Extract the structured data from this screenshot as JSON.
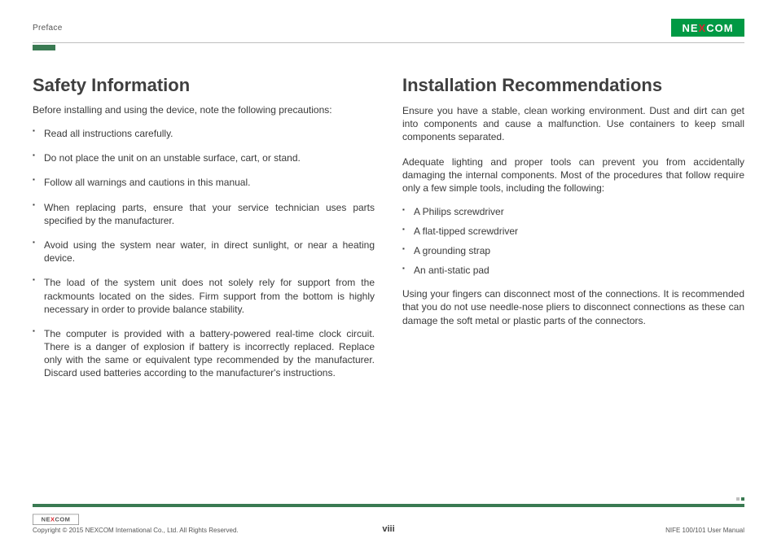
{
  "header": {
    "section_label": "Preface",
    "logo_text": "NEXCOM"
  },
  "left_column": {
    "heading": "Safety Information",
    "intro": "Before installing and using the device, note the following precautions:",
    "bullets": [
      "Read all instructions carefully.",
      "Do not place the unit on an unstable surface, cart, or stand.",
      "Follow all warnings and cautions in this manual.",
      "When replacing parts, ensure that your service technician uses parts specified by the manufacturer.",
      "Avoid using the system near water, in direct sunlight, or near a heating device.",
      "The load of the system unit does not solely rely for support from the rackmounts located on the sides. Firm support from the bottom is highly necessary in order to provide balance stability.",
      "The computer is provided with a battery-powered real-time clock circuit. There is a danger of explosion if battery is incorrectly replaced. Replace only with the same or equivalent type recommended by the manufacturer. Discard used batteries according to the manufacturer's instructions."
    ]
  },
  "right_column": {
    "heading": "Installation Recommendations",
    "para1": "Ensure you have a stable, clean working environment. Dust and dirt can get into components and cause a malfunction. Use containers to keep small components separated.",
    "para2": "Adequate lighting and proper tools can prevent you from accidentally damaging the internal components. Most of the procedures that follow require only a few simple tools, including the following:",
    "tools": [
      "A Philips screwdriver",
      "A flat-tipped screwdriver",
      "A grounding strap",
      "An anti-static pad"
    ],
    "para3": "Using your fingers can disconnect most of the connections. It is recommended that you do not use needle-nose pliers to disconnect connections as these can damage the soft metal or plastic parts of the connectors."
  },
  "footer": {
    "logo_text": "NEXCOM",
    "copyright": "Copyright © 2015 NEXCOM International Co., Ltd. All Rights Reserved.",
    "page_number": "viii",
    "manual_name": "NIFE 100/101 User Manual"
  }
}
